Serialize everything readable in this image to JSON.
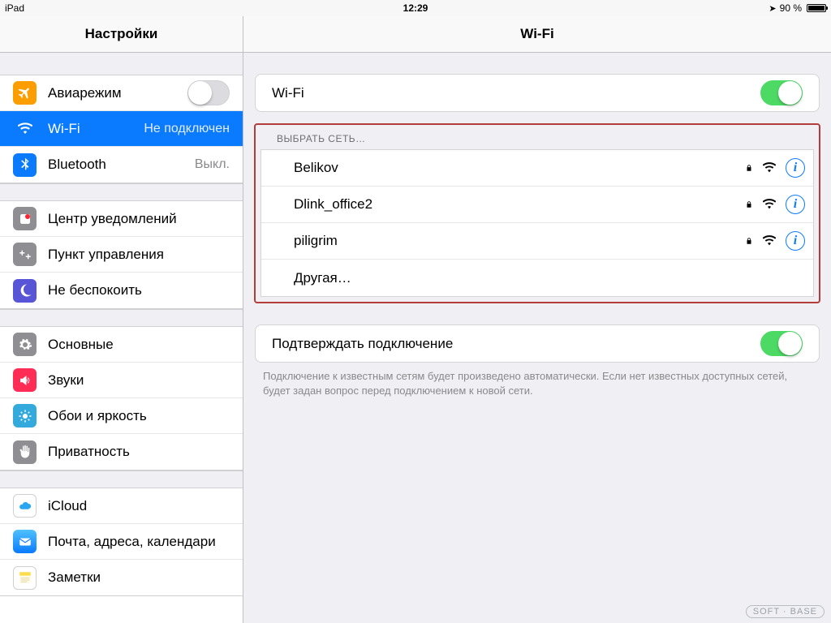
{
  "statusbar": {
    "device": "iPad",
    "time": "12:29",
    "battery_pct": "90 %"
  },
  "header": {
    "settings_title": "Настройки",
    "detail_title": "Wi-Fi"
  },
  "sidebar": {
    "group1": {
      "airplane": {
        "label": "Авиарежим",
        "on": false
      },
      "wifi": {
        "label": "Wi-Fi",
        "status": "Не подключен"
      },
      "bluetooth": {
        "label": "Bluetooth",
        "status": "Выкл."
      }
    },
    "group2": {
      "notifications": {
        "label": "Центр уведомлений"
      },
      "controlcenter": {
        "label": "Пункт управления"
      },
      "dnd": {
        "label": "Не беспокоить"
      }
    },
    "group3": {
      "general": {
        "label": "Основные"
      },
      "sounds": {
        "label": "Звуки"
      },
      "wallpaper": {
        "label": "Обои и яркость"
      },
      "privacy": {
        "label": "Приватность"
      }
    },
    "group4": {
      "icloud": {
        "label": "iCloud"
      },
      "mail": {
        "label": "Почта, адреса, календари"
      },
      "notes": {
        "label": "Заметки"
      }
    }
  },
  "detail": {
    "wifi_toggle_label": "Wi-Fi",
    "wifi_toggle_on": true,
    "choose_network_header": "ВЫБРАТЬ СЕТЬ…",
    "networks": [
      {
        "name": "Belikov",
        "locked": true,
        "signal": 3
      },
      {
        "name": "Dlink_office2",
        "locked": true,
        "signal": 3
      },
      {
        "name": "piligrim",
        "locked": true,
        "signal": 3
      }
    ],
    "other_label": "Другая…",
    "ask_to_join_label": "Подтверждать подключение",
    "ask_to_join_on": true,
    "ask_to_join_footer": "Подключение к известным сетям будет произведено автоматически. Если нет известных доступных сетей, будет задан вопрос перед подключением к новой сети."
  },
  "watermark": "SOFT · BASE"
}
